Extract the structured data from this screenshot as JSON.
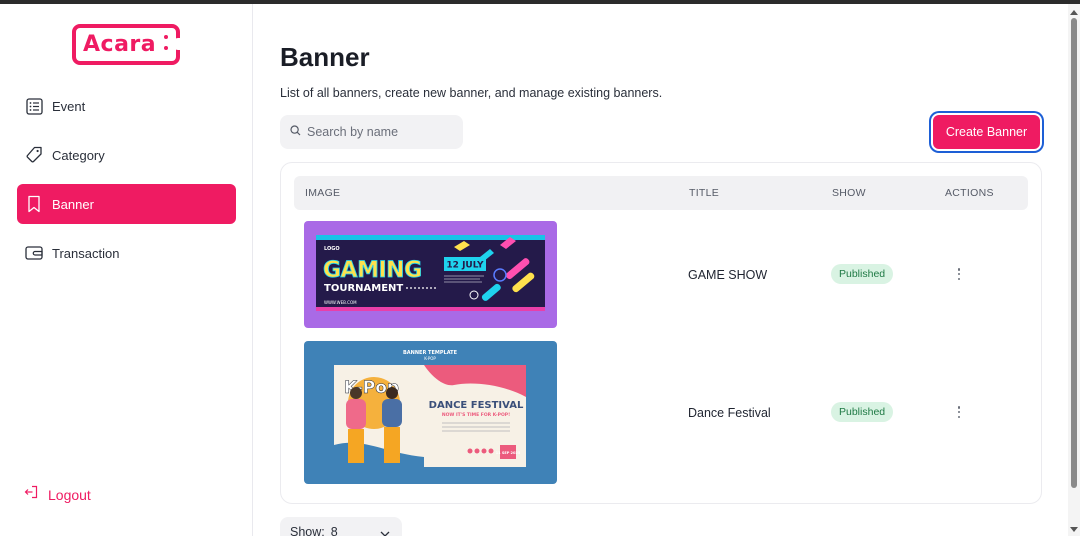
{
  "brand": {
    "logo_text": "Acara",
    "accent": "#ef1b62"
  },
  "sidebar": {
    "items": [
      {
        "label": "Event",
        "icon": "list-icon",
        "active": false
      },
      {
        "label": "Category",
        "icon": "tag-icon",
        "active": false
      },
      {
        "label": "Banner",
        "icon": "bookmark-icon",
        "active": true
      },
      {
        "label": "Transaction",
        "icon": "wallet-icon",
        "active": false
      }
    ],
    "logout_label": "Logout"
  },
  "page": {
    "title": "Banner",
    "description": "List of all banners, create new banner, and manage existing banners."
  },
  "search": {
    "placeholder": "Search by name",
    "value": ""
  },
  "create_button_label": "Create Banner",
  "table": {
    "columns": [
      "IMAGE",
      "TITLE",
      "SHOW",
      "ACTIONS"
    ],
    "rows": [
      {
        "title": "GAME SHOW",
        "status": "Published",
        "image": {
          "logo": "LOGO",
          "headline": "GAMING",
          "subline": "TOURNAMENT",
          "date": "12 JULY",
          "website": "WWW.WEB.COM"
        }
      },
      {
        "title": "Dance Festival",
        "status": "Published",
        "image": {
          "template_label": "BANNER TEMPLATE",
          "template_sub": "K-POP",
          "kpop": "K-Pop",
          "headline": "DANCE FESTIVAL",
          "subline": "NOW IT'S TIME FOR K-POP!",
          "date_badge": "11 SEP 2025"
        }
      }
    ]
  },
  "pagination": {
    "show_label": "Show:",
    "show_value": "8"
  },
  "colors": {
    "status_bg": "#d9f3e3",
    "status_text": "#1f7a45",
    "focus_ring": "#1d5fd6"
  }
}
